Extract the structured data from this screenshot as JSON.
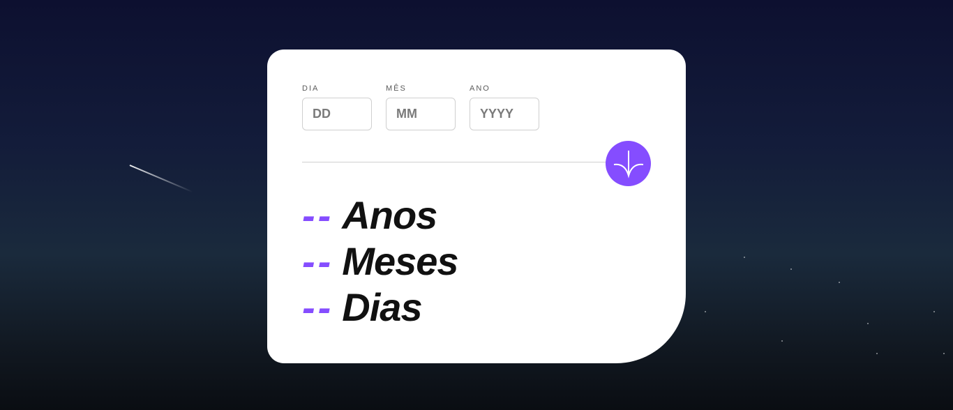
{
  "form": {
    "day": {
      "label": "DIA",
      "placeholder": "DD",
      "value": ""
    },
    "month": {
      "label": "MÊS",
      "placeholder": "MM",
      "value": ""
    },
    "year": {
      "label": "ANO",
      "placeholder": "YYYY",
      "value": ""
    }
  },
  "submit": {
    "icon": "arrow-down-icon",
    "color": "#854dff"
  },
  "results": [
    {
      "value": "--",
      "label": "Anos"
    },
    {
      "value": "--",
      "label": "Meses"
    },
    {
      "value": "--",
      "label": "Dias"
    }
  ],
  "colors": {
    "accent": "#854dff",
    "card": "#ffffff",
    "text": "#111111"
  }
}
